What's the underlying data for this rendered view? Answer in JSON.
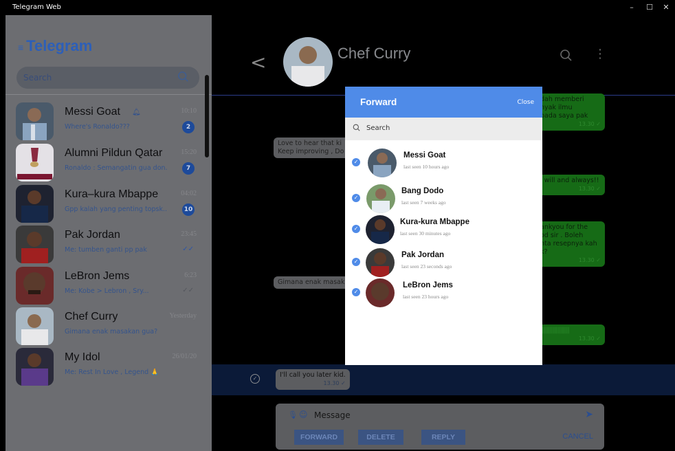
{
  "window": {
    "title": "Telegram Web",
    "min": "–",
    "max": "☐",
    "close": "✕"
  },
  "sidebar": {
    "brand": "Telegram",
    "menu_icon": "≡",
    "search_placeholder": "Search",
    "chats": [
      {
        "name": "Messi Goat",
        "preview": "Where's Ronaldo???",
        "time": "10:10",
        "badge": "2",
        "muted": true
      },
      {
        "name": "Alumni Pildun Qatar",
        "preview": "Ronaldo : Semangatin gua don...",
        "time": "15:20",
        "badge": "7"
      },
      {
        "name": "Kura–kura Mbappe",
        "preview": "Gpp kalah yang penting topsk..",
        "time": "04:02",
        "badge": "10"
      },
      {
        "name": "Pak Jordan",
        "preview": "Me: tumben ganti pp pak",
        "time": "23:45",
        "ticks": "✓✓"
      },
      {
        "name": "LeBron Jems",
        "preview": "Me: Kobe > Lebron , Sry...",
        "time": "6:23",
        "ticks": "✓✓"
      },
      {
        "name": "Chef Curry",
        "preview": "Gimana enak masakan gua?",
        "time": "Yesterday"
      },
      {
        "name": "My Idol",
        "preview": "Me: Rest In Love , Legend 🙏",
        "time": "26/01/20"
      }
    ]
  },
  "chat": {
    "back_glyph": "<",
    "title": "Chef Curry",
    "more_glyph": "⋮",
    "messages_out": [
      {
        "text": "dah memberi\nnyak ilmu\npada saya pak",
        "time": "13.30 ✓"
      },
      {
        "text": "i will and always!!",
        "time": "13.30 ✓"
      },
      {
        "text": "ankyou for the\nod sir . Boleh\nnta resepnya kah\nk?",
        "time": "13.30 ✓"
      },
      {
        "text": "|||||||||||||||||||",
        "time": "13.30 ✓"
      }
    ],
    "messages_in": [
      {
        "text": "Love to hear that ki\nKeep improving , Do"
      },
      {
        "text": "Gimana enak masak"
      }
    ],
    "selected_message": {
      "text": "I'll call you later kid.",
      "time": "13.30 ✓"
    },
    "composer": {
      "placeholder": "Message",
      "forward": "FORWARD",
      "delete": "DELETE",
      "reply": "REPLY",
      "cancel": "CANCEL"
    }
  },
  "forward_modal": {
    "title": "Forward",
    "close": "Close",
    "search_placeholder": "Search",
    "contacts": [
      {
        "name": "Messi Goat",
        "status": "last seen 10 hours ago"
      },
      {
        "name": "Bang Dodo",
        "status": "last seen 7 weeks ago"
      },
      {
        "name": "Kura-kura Mbappe",
        "status": "last seen 30 minutes ago"
      },
      {
        "name": "Pak Jordan",
        "status": "last seen 23 seconds ago"
      },
      {
        "name": "LeBron Jems",
        "status": "last seen 23 hours ago"
      }
    ]
  },
  "colors": {
    "accent": "#4f8be8",
    "sidebar": "#6c6d71",
    "bubble_out": "#166b16"
  }
}
